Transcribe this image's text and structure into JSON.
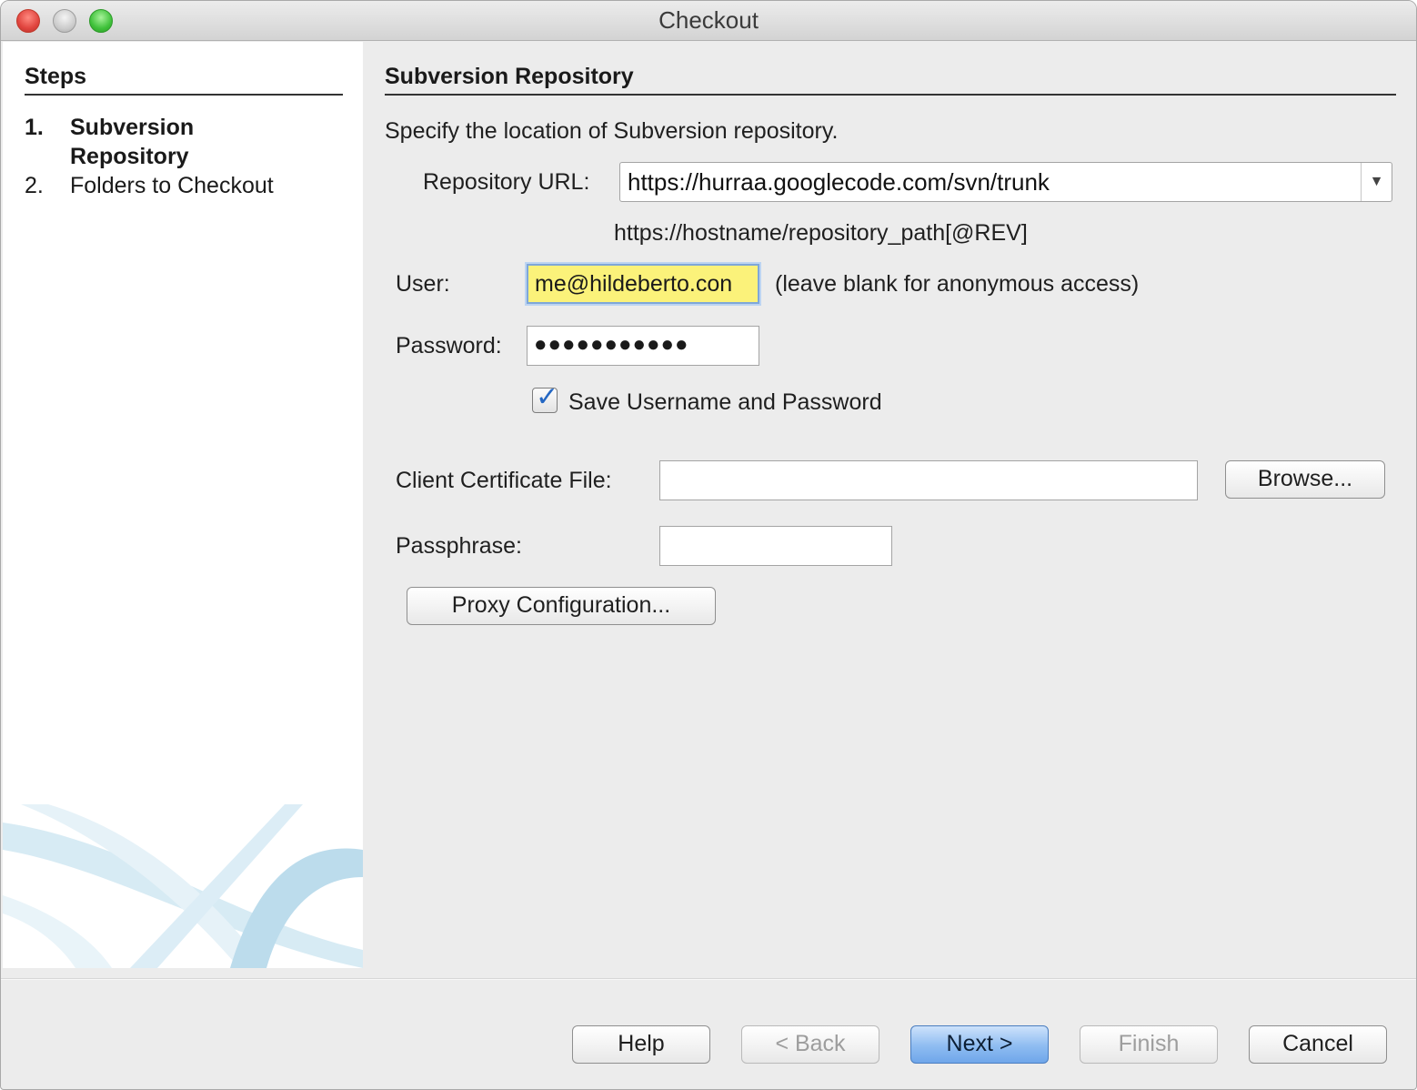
{
  "window": {
    "title": "Checkout"
  },
  "steps": {
    "heading": "Steps",
    "items": [
      {
        "number": "1.",
        "label_line1": "Subversion",
        "label_line2": "Repository",
        "current": true
      },
      {
        "number": "2.",
        "label_line1": "Folders to Checkout",
        "current": false
      }
    ]
  },
  "main": {
    "heading": "Subversion Repository",
    "description": "Specify the location of Subversion repository.",
    "repository_url": {
      "label": "Repository URL:",
      "value": "https://hurraa.googlecode.com/svn/trunk",
      "hint": "https://hostname/repository_path[@REV]"
    },
    "user": {
      "label": "User:",
      "value": "me@hildeberto.con",
      "hint": "(leave blank for anonymous access)"
    },
    "password": {
      "label": "Password:",
      "value": "●●●●●●●●●●●"
    },
    "save_credentials": {
      "label": "Save Username and Password",
      "checked": true
    },
    "client_certificate": {
      "label": "Client Certificate File:",
      "value": "",
      "browse_label": "Browse..."
    },
    "passphrase": {
      "label": "Passphrase:",
      "value": ""
    },
    "proxy_button": "Proxy Configuration..."
  },
  "buttons": {
    "help": "Help",
    "back": "< Back",
    "next": "Next >",
    "finish": "Finish",
    "cancel": "Cancel"
  },
  "colors": {
    "user_field_highlight": "#fbf27a",
    "default_button": "#8ebcf1",
    "checkmark": "#2467c3"
  }
}
